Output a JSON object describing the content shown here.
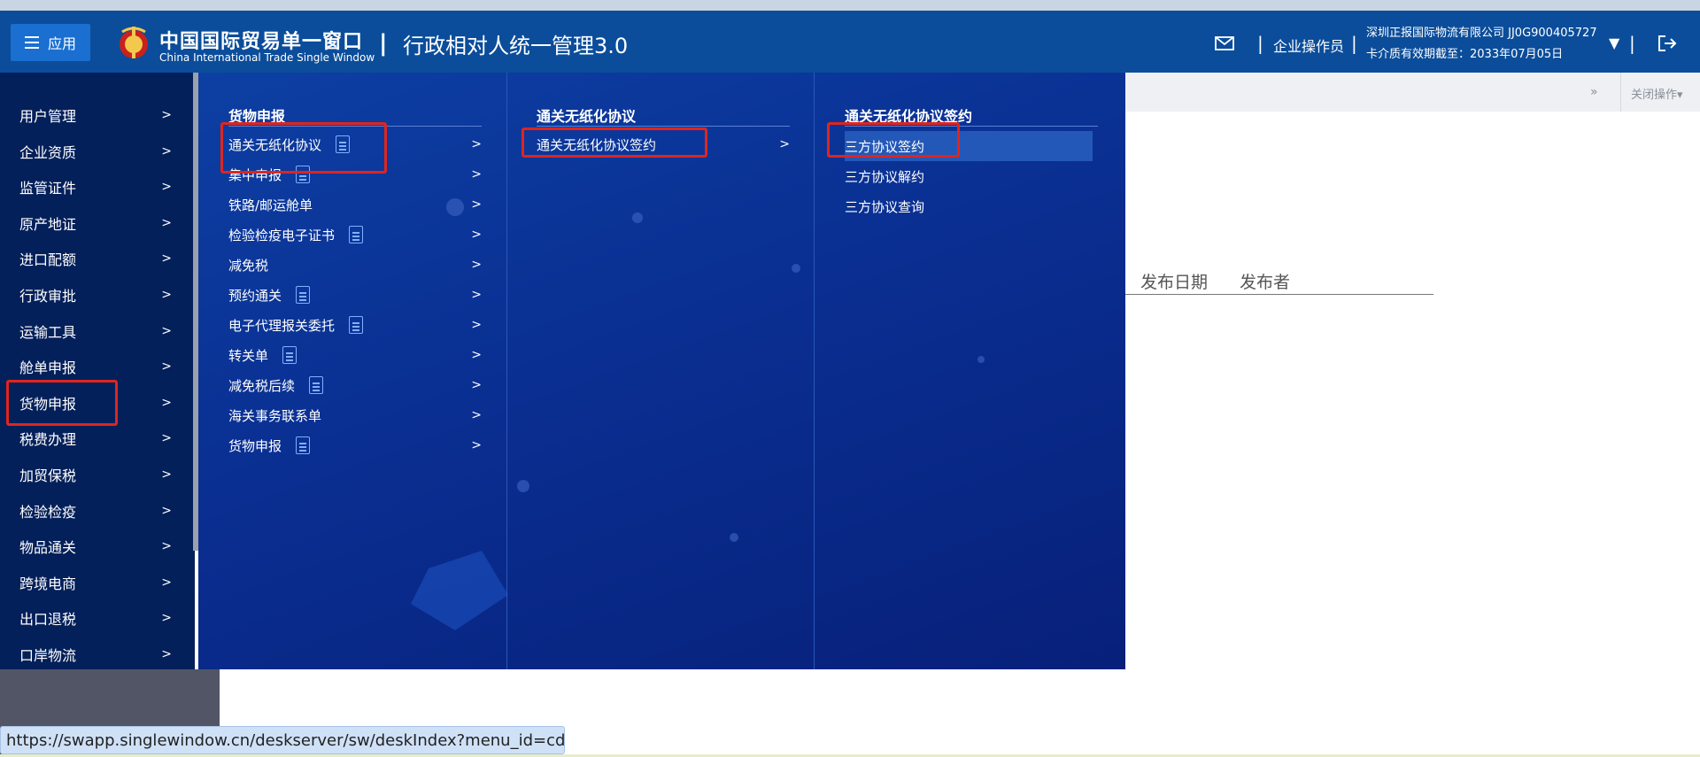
{
  "header": {
    "app_button_label": "应用",
    "brand_cn": "中国国际贸易单一窗口",
    "brand_en": "China International Trade Single Window",
    "separator": "|",
    "system_title": "行政相对人统一管理3.0",
    "role_label": "企业操作员",
    "company": "深圳正报国际物流有限公司 JJ0G900405727",
    "validity": "卡介质有效期截至：2033年07月05日",
    "caret": "▼"
  },
  "sidebar": {
    "items": [
      {
        "label": "用户管理"
      },
      {
        "label": "企业资质"
      },
      {
        "label": "监管证件"
      },
      {
        "label": "原产地证"
      },
      {
        "label": "进口配额"
      },
      {
        "label": "行政审批"
      },
      {
        "label": "运输工具"
      },
      {
        "label": "舱单申报"
      },
      {
        "label": "货物申报"
      },
      {
        "label": "税费办理"
      },
      {
        "label": "加贸保税"
      },
      {
        "label": "检验检疫"
      },
      {
        "label": "物品通关"
      },
      {
        "label": "跨境电商"
      },
      {
        "label": "出口退税"
      },
      {
        "label": "口岸物流"
      }
    ],
    "chevron": ">"
  },
  "menu": {
    "col1": {
      "title": "货物申报",
      "items": [
        {
          "label": "通关无纸化协议"
        },
        {
          "label": "集中申报"
        },
        {
          "label": "铁路/邮运舱单"
        },
        {
          "label": "检验检疫电子证书"
        },
        {
          "label": "减免税"
        },
        {
          "label": "预约通关"
        },
        {
          "label": "电子代理报关委托"
        },
        {
          "label": "转关单"
        },
        {
          "label": "减免税后续"
        },
        {
          "label": "海关事务联系单"
        },
        {
          "label": "货物申报"
        }
      ]
    },
    "col2": {
      "title": "通关无纸化协议",
      "items": [
        {
          "label": "通关无纸化协议签约"
        }
      ]
    },
    "col3": {
      "title": "通关无纸化协议签约",
      "items": [
        {
          "label": "三方协议签约"
        },
        {
          "label": "三方协议解约"
        },
        {
          "label": "三方协议查询"
        }
      ]
    }
  },
  "content": {
    "close_ops": "关闭操作",
    "forward_icon": "»",
    "col_date": "发布日期",
    "col_publisher": "发布者"
  },
  "status": {
    "url": "https://swapp.singlewindow.cn/deskserver/sw/deskIndex?menu_id=cd..."
  },
  "colors": {
    "header_bg": "#0b4d9a",
    "sidebar_bg": "#04205a",
    "menu_bg": "#0a2f92",
    "highlight": "#e0251c"
  }
}
